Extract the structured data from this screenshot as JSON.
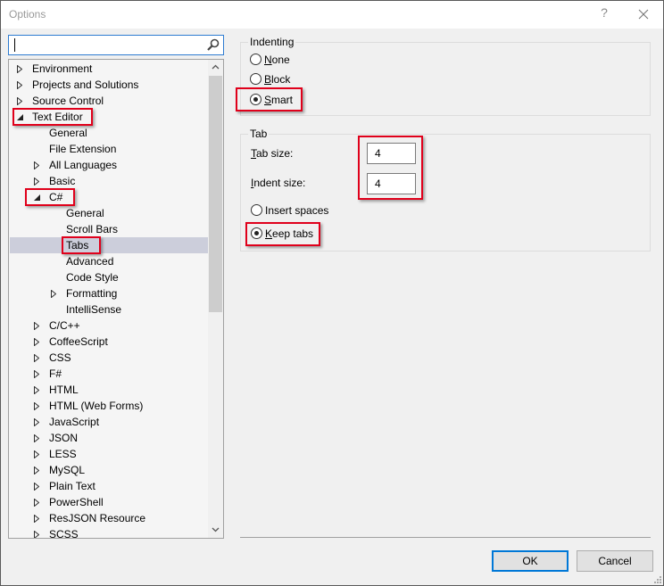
{
  "window": {
    "title": "Options",
    "help_label": "?",
    "close_label": "✕"
  },
  "search": {
    "value": "",
    "placeholder": ""
  },
  "tree": {
    "items": [
      {
        "label": "Environment",
        "level": 0,
        "expander": "collapsed"
      },
      {
        "label": "Projects and Solutions",
        "level": 0,
        "expander": "collapsed"
      },
      {
        "label": "Source Control",
        "level": 0,
        "expander": "collapsed"
      },
      {
        "label": "Text Editor",
        "level": 0,
        "expander": "expanded",
        "highlighted": true
      },
      {
        "label": "General",
        "level": 1,
        "expander": "none"
      },
      {
        "label": "File Extension",
        "level": 1,
        "expander": "none"
      },
      {
        "label": "All Languages",
        "level": 1,
        "expander": "collapsed"
      },
      {
        "label": "Basic",
        "level": 1,
        "expander": "collapsed"
      },
      {
        "label": "C#",
        "level": 1,
        "expander": "expanded",
        "highlighted": true
      },
      {
        "label": "General",
        "level": 2,
        "expander": "none"
      },
      {
        "label": "Scroll Bars",
        "level": 2,
        "expander": "none"
      },
      {
        "label": "Tabs",
        "level": 2,
        "expander": "none",
        "selected": true,
        "highlighted": true
      },
      {
        "label": "Advanced",
        "level": 2,
        "expander": "none"
      },
      {
        "label": "Code Style",
        "level": 2,
        "expander": "none"
      },
      {
        "label": "Formatting",
        "level": 2,
        "expander": "collapsed"
      },
      {
        "label": "IntelliSense",
        "level": 2,
        "expander": "none"
      },
      {
        "label": "C/C++",
        "level": 1,
        "expander": "collapsed"
      },
      {
        "label": "CoffeeScript",
        "level": 1,
        "expander": "collapsed"
      },
      {
        "label": "CSS",
        "level": 1,
        "expander": "collapsed"
      },
      {
        "label": "F#",
        "level": 1,
        "expander": "collapsed"
      },
      {
        "label": "HTML",
        "level": 1,
        "expander": "collapsed"
      },
      {
        "label": "HTML (Web Forms)",
        "level": 1,
        "expander": "collapsed"
      },
      {
        "label": "JavaScript",
        "level": 1,
        "expander": "collapsed"
      },
      {
        "label": "JSON",
        "level": 1,
        "expander": "collapsed"
      },
      {
        "label": "LESS",
        "level": 1,
        "expander": "collapsed"
      },
      {
        "label": "MySQL",
        "level": 1,
        "expander": "collapsed"
      },
      {
        "label": "Plain Text",
        "level": 1,
        "expander": "collapsed"
      },
      {
        "label": "PowerShell",
        "level": 1,
        "expander": "collapsed"
      },
      {
        "label": "ResJSON Resource",
        "level": 1,
        "expander": "collapsed"
      },
      {
        "label": "SCSS",
        "level": 1,
        "expander": "collapsed"
      }
    ]
  },
  "indenting": {
    "legend": "Indenting",
    "options": [
      {
        "label": "None",
        "access_key": "N",
        "rest": "one",
        "checked": false
      },
      {
        "label": "Block",
        "access_key": "B",
        "rest": "lock",
        "checked": false
      },
      {
        "label": "Smart",
        "access_key": "S",
        "rest": "mart",
        "checked": true
      }
    ]
  },
  "tab": {
    "legend": "Tab",
    "tab_size_label_key": "T",
    "tab_size_label_rest": "ab size:",
    "tab_size_value": "4",
    "indent_size_label_key": "I",
    "indent_size_label_rest": "ndent size:",
    "indent_size_value": "4",
    "options": [
      {
        "label": "Insert spaces",
        "access_key": "",
        "rest": "Insert spaces",
        "checked": false
      },
      {
        "label": "Keep tabs",
        "access_key": "K",
        "rest": "eep tabs",
        "checked": true
      }
    ]
  },
  "buttons": {
    "ok": "OK",
    "cancel": "Cancel"
  },
  "colors": {
    "highlight": "#e0001b",
    "focus": "#0078d7",
    "selected_row": "#cccedb"
  }
}
